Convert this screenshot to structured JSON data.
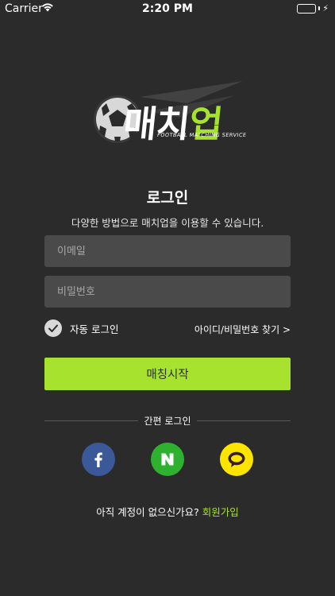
{
  "status_bar": {
    "carrier": "Carrier",
    "time": "2:20 PM"
  },
  "logo": {
    "text_main": "매치",
    "text_accent": "업",
    "subtitle": "FOOTBALL MATCHING SERVICE"
  },
  "login": {
    "title": "로그인",
    "subtitle": "다양한 방법으로 매치업을 이용할 수 있습니다.",
    "email_placeholder": "이메일",
    "password_placeholder": "비밀번호",
    "auto_login_label": "자동 로그인",
    "auto_login_checked": true,
    "find_account_link": "아이디/비밀번호 찾기 >",
    "start_button": "매칭시작"
  },
  "easy_login": {
    "label": "간편 로그인",
    "providers": [
      "facebook-icon",
      "naver-icon",
      "kakao-icon"
    ]
  },
  "signup": {
    "prompt": "아직 계정이 없으신가요?",
    "link": "회원가입"
  },
  "colors": {
    "background": "#2b2b2b",
    "accent": "#a6e22e",
    "field": "#4a4a4a",
    "facebook": "#3b5998",
    "naver": "#2fb130",
    "kakao": "#fee500"
  }
}
